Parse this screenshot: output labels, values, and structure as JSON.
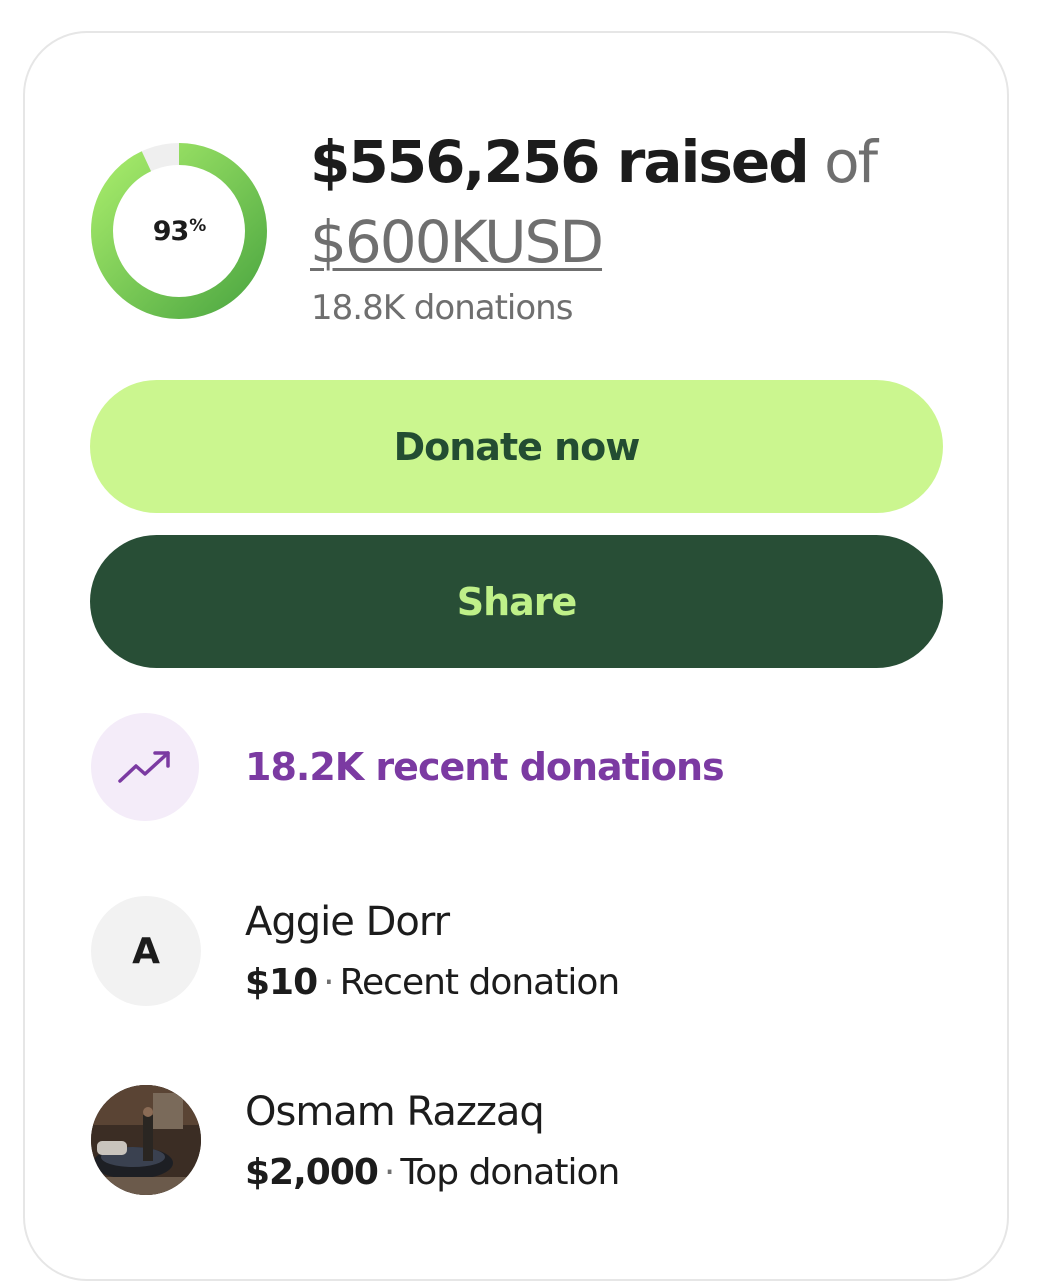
{
  "fundraiser": {
    "progress_percent": 93,
    "progress_label_number": "93",
    "progress_label_symbol": "%",
    "raised_amount": "$556,256 raised",
    "of_text": "of",
    "goal_text": "$600KUSD",
    "donations_count": "18.8K donations"
  },
  "actions": {
    "donate_label": "Donate now",
    "share_label": "Share"
  },
  "trend": {
    "icon": "trending-up-icon",
    "text": "18.2K recent donations"
  },
  "donors": [
    {
      "name": "Aggie Dorr",
      "avatar_initial": "A",
      "amount": "$10",
      "separator": "·",
      "label": "Recent donation"
    },
    {
      "name": "Osmam Razzaq",
      "avatar": "photo",
      "amount": "$2,000",
      "separator": "·",
      "label": "Top donation"
    }
  ],
  "colors": {
    "ring_track": "#efefef",
    "ring_fill_start": "#4ea842",
    "ring_fill_end": "#a8ec6b",
    "donate_bg": "#cbf68f",
    "donate_text": "#234d32",
    "share_bg": "#284e36",
    "share_text": "#bff089",
    "trend_accent": "#7b3aa2",
    "trend_bg": "#f4ecf9"
  }
}
